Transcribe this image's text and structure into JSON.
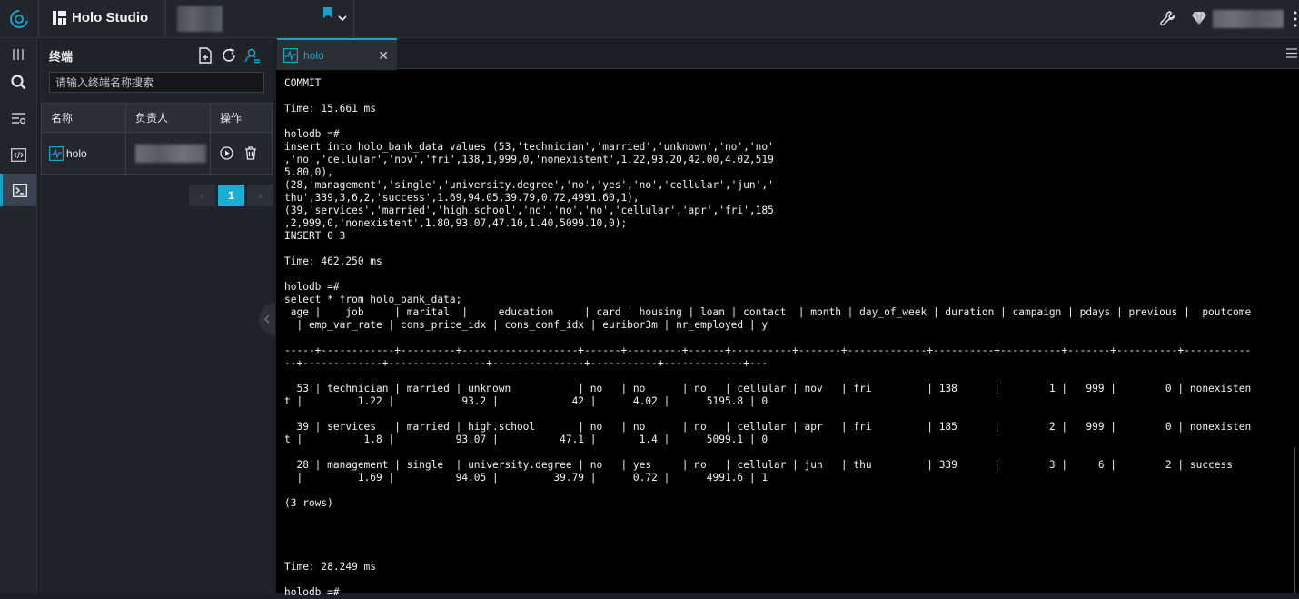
{
  "app": {
    "title": "Holo Studio"
  },
  "sidebar": {
    "title": "终端",
    "search_placeholder": "请输入终端名称搜索",
    "columns": [
      "名称",
      "负责人",
      "操作"
    ],
    "rows": [
      {
        "name": "holo"
      }
    ],
    "pagination": {
      "current": "1"
    }
  },
  "editor": {
    "tab_label": "holo",
    "terminal_lines": [
      "COMMIT",
      "",
      "Time: 15.661 ms",
      "",
      "holodb =#",
      "insert into holo_bank_data values (53,'technician','married','unknown','no','no'",
      ",'no','cellular','nov','fri',138,1,999,0,'nonexistent',1.22,93.20,42.00,4.02,519",
      "5.80,0),",
      "(28,'management','single','university.degree','no','yes','no','cellular','jun','",
      "thu',339,3,6,2,'success',1.69,94.05,39.79,0.72,4991.60,1),",
      "(39,'services','married','high.school','no','no','no','cellular','apr','fri',185",
      ",2,999,0,'nonexistent',1.80,93.07,47.10,1.40,5099.10,0);",
      "INSERT 0 3",
      "",
      "Time: 462.250 ms",
      "",
      "holodb =#",
      "select * from holo_bank_data;",
      " age |    job     | marital  |     education     | card | housing | loan | contact  | month | day_of_week | duration | campaign | pdays | previous |  poutcome",
      "  | emp_var_rate | cons_price_idx | cons_conf_idx | euribor3m | nr_employed | y",
      "",
      "-----+------------+---------+-------------------+------+---------+------+----------+-------+-------------+----------+----------+-------+----------+-----------",
      "--+-------------+----------------+---------------+-----------+-------------+---",
      "",
      "  53 | technician | married | unknown           | no   | no      | no   | cellular | nov   | fri         | 138      |        1 |   999 |        0 | nonexisten",
      "t |         1.22 |           93.2 |            42 |      4.02 |      5195.8 | 0",
      "",
      "  39 | services   | married | high.school       | no   | no      | no   | cellular | apr   | fri         | 185      |        2 |   999 |        0 | nonexisten",
      "t |          1.8 |          93.07 |          47.1 |       1.4 |      5099.1 | 0",
      "",
      "  28 | management | single  | university.degree | no   | yes     | no   | cellular | jun   | thu         | 339      |        3 |     6 |        2 | success",
      "  |         1.69 |          94.05 |         39.79 |      0.72 |      4991.6 | 1",
      "",
      "(3 rows)",
      "",
      "",
      "",
      "",
      "Time: 28.249 ms",
      "",
      "holodb =#"
    ]
  },
  "colors": {
    "accent": "#1aa1c7",
    "page_button": "#1aaed1"
  }
}
